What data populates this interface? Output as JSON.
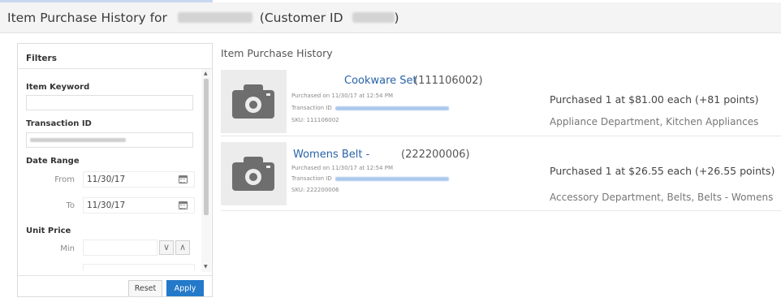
{
  "header": {
    "title_prefix": "Item Purchase History for",
    "customer_id_label": "(Customer ID",
    "customer_id_suffix": ")"
  },
  "filters": {
    "title": "Filters",
    "item_keyword_label": "Item Keyword",
    "item_keyword_value": "",
    "transaction_id_label": "Transaction ID",
    "date_range_label": "Date Range",
    "from_label": "From",
    "from_value": "11/30/17",
    "to_label": "To",
    "to_value": "11/30/17",
    "unit_price_label": "Unit Price",
    "min_label": "Min",
    "min_value": "",
    "stepper_down": "∨",
    "stepper_up": "∧",
    "reset_label": "Reset",
    "apply_label": "Apply"
  },
  "main": {
    "title": "Item Purchase History",
    "items": [
      {
        "name": "Cookware Set",
        "id": "(111106002)",
        "purchased_on": "Purchased on 11/30/17 at 12:54 PM",
        "transaction_label": "Transaction ID",
        "sku": "SKU: 111106002",
        "price_line": "Purchased 1 at $81.00 each (+81 points)",
        "department": "Appliance Department, Kitchen Appliances"
      },
      {
        "name": "Womens Belt -",
        "id": "(222200006)",
        "purchased_on": "Purchased on 11/30/17 at 12:54 PM",
        "transaction_label": "Transaction ID",
        "sku": "SKU: 222200006",
        "price_line": "Purchased 1 at $26.55 each (+26.55 points)",
        "department": "Accessory Department, Belts, Belts - Womens"
      }
    ]
  },
  "colors": {
    "link": "#2a63a8",
    "apply_button": "#2479c9",
    "header_bg": "#f4f4f4"
  },
  "icons": {
    "product_placeholder": "camera-icon",
    "date_picker": "calendar-icon"
  }
}
